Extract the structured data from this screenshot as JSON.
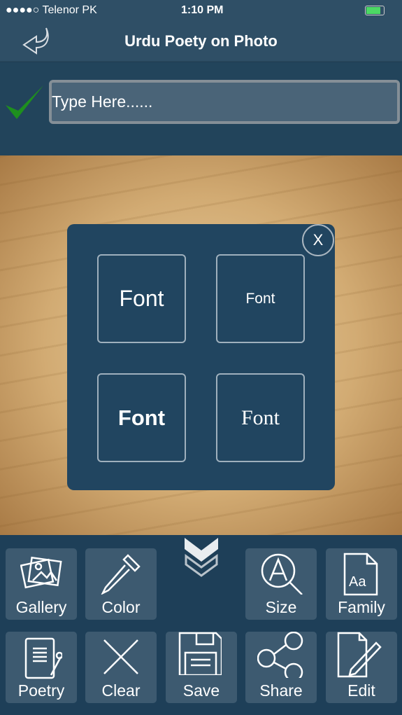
{
  "status": {
    "carrier": "●●●●○ Telenor PK",
    "time": "1:10 PM",
    "battery_color": "#4cd964"
  },
  "nav": {
    "title": "Urdu Poety on Photo",
    "back_icon": "back-arrow-icon"
  },
  "input": {
    "placeholder": "Type Here......",
    "confirm_icon": "checkmark-icon",
    "confirm_color": "#1e8f1e"
  },
  "popup": {
    "close_label": "X",
    "options": [
      {
        "label": "Font",
        "style": "regular-large"
      },
      {
        "label": "Font",
        "style": "regular-small"
      },
      {
        "label": "Font",
        "style": "bold"
      },
      {
        "label": "Font",
        "style": "serif"
      }
    ]
  },
  "toolbar": {
    "collapse_icon": "double-chevron-down-icon",
    "buttons": [
      {
        "label": "Gallery",
        "icon": "gallery-icon"
      },
      {
        "label": "Color",
        "icon": "eyedropper-icon"
      },
      {
        "label": "Size",
        "icon": "text-size-icon"
      },
      {
        "label": "Family",
        "icon": "font-family-icon"
      },
      {
        "label": "Poetry",
        "icon": "poetry-icon"
      },
      {
        "label": "Clear",
        "icon": "clear-icon"
      },
      {
        "label": "Save",
        "icon": "save-icon"
      },
      {
        "label": "Share",
        "icon": "share-icon"
      },
      {
        "label": "Edit",
        "icon": "edit-icon"
      }
    ]
  }
}
